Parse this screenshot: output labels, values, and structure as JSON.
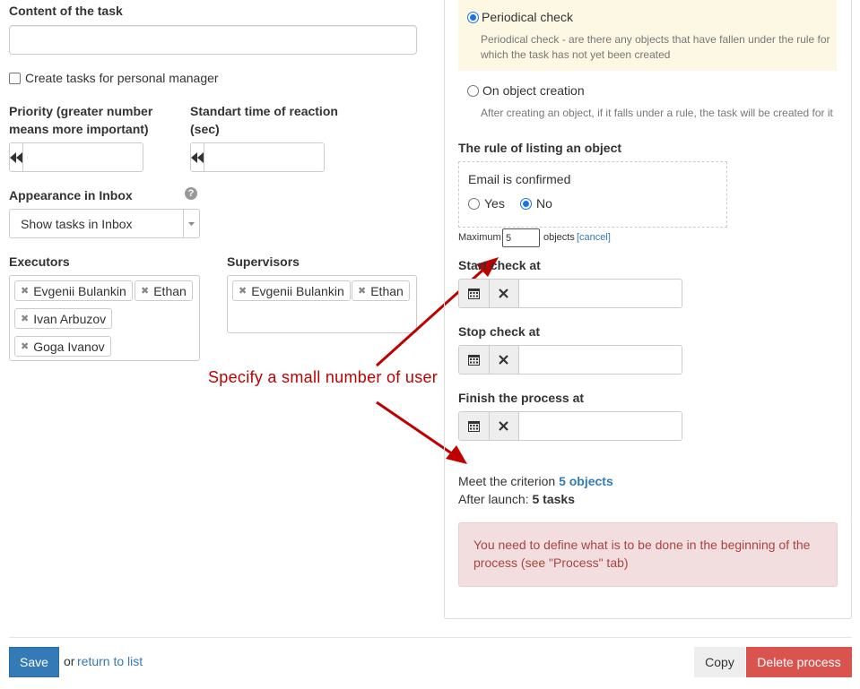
{
  "task": {
    "content_label": "Content of the task",
    "content_value": "",
    "personal_manager_label": "Create tasks for personal manager"
  },
  "priority": {
    "label_line1": "Priority (greater number",
    "label_line2": "means more important)",
    "value": ""
  },
  "reaction": {
    "label_line1": "Standart time of reaction",
    "label_line2": "(sec)",
    "value": ""
  },
  "inbox": {
    "label": "Appearance in Inbox",
    "selected": "Show tasks in Inbox"
  },
  "executors": {
    "label": "Executors",
    "tags": [
      "Evgenii Bulankin",
      "Ethan",
      "Ivan Arbuzov",
      "Goga Ivanov"
    ]
  },
  "supervisors": {
    "label": "Supervisors",
    "tags": [
      "Evgenii Bulankin",
      "Ethan"
    ]
  },
  "annotation": {
    "text": "Specify a small number of user",
    "color": "#c00000"
  },
  "trigger": {
    "periodical_label": "Periodical check",
    "periodical_desc_line1": "Periodical check - are there any objects that have fallen under the rule for",
    "periodical_desc_line2": "which the task has not yet been created",
    "creation_label": "On object creation",
    "creation_desc": "After creating an object, if it falls under a rule, the task will be created for it"
  },
  "rule": {
    "title": "The rule of listing an object",
    "condition_label": "Email is confirmed",
    "yes_label": "Yes",
    "no_label": "No",
    "maximum_label": "Maximum",
    "maximum_value": "5",
    "objects_label": "objects",
    "cancel_label": "[cancel]"
  },
  "dates": {
    "start_label": "Start check at",
    "stop_label": "Stop check at",
    "finish_label": "Finish the process at"
  },
  "summary": {
    "criterion_label": "Meet the criterion",
    "criterion_value": "5 objects",
    "launch_label": "After launch:",
    "launch_value": "5 tasks"
  },
  "alert": {
    "line1": "You need to define what is to be done in the beginning of the",
    "line2": "process (see \"Process\" tab)"
  },
  "footer": {
    "save_label": "Save",
    "or_label": "or",
    "return_label": "return to list",
    "copy_label": "Copy",
    "delete_label": "Delete process"
  },
  "colors": {
    "primary": "#337ab7",
    "danger": "#d9534f",
    "highlight": "#fcf8e3",
    "alert_bg": "#f2dede",
    "alert_text": "#a94442"
  }
}
